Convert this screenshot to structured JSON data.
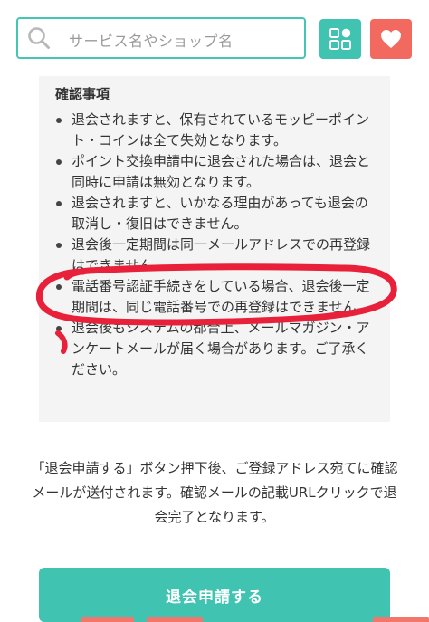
{
  "header": {
    "search_placeholder": "サービス名やショップ名",
    "grid_icon": "grid-icon",
    "favorite_icon": "heart-icon"
  },
  "notice": {
    "title": "確認事項",
    "items": [
      "退会されますと、保有されているモッピーポイント・コインは全て失効となります。",
      "ポイント交換申請中に退会された場合は、退会と同時に申請は無効となります。",
      "退会されますと、いかなる理由があっても退会の取消し・復旧はできません。",
      "退会後一定期間は同一メールアドレスでの再登録はできません。",
      "電話番号認証手続きをしている場合、退会後一定期間は、同じ電話番号での再登録はできません。",
      "退会後もシステムの都合上、メールマガジン・アンケートメールが届く場合があります。ご了承ください。"
    ]
  },
  "info": {
    "text": "「退会申請する」ボタン押下後、ご登録アドレス宛てに確認メールが送付されます。確認メールの記載URLクリックで退会完了となります。"
  },
  "cta": {
    "label": "退会申請する"
  },
  "colors": {
    "accent": "#41c3b1",
    "favorite": "#f26a5f",
    "highlight": "#e8203a"
  }
}
